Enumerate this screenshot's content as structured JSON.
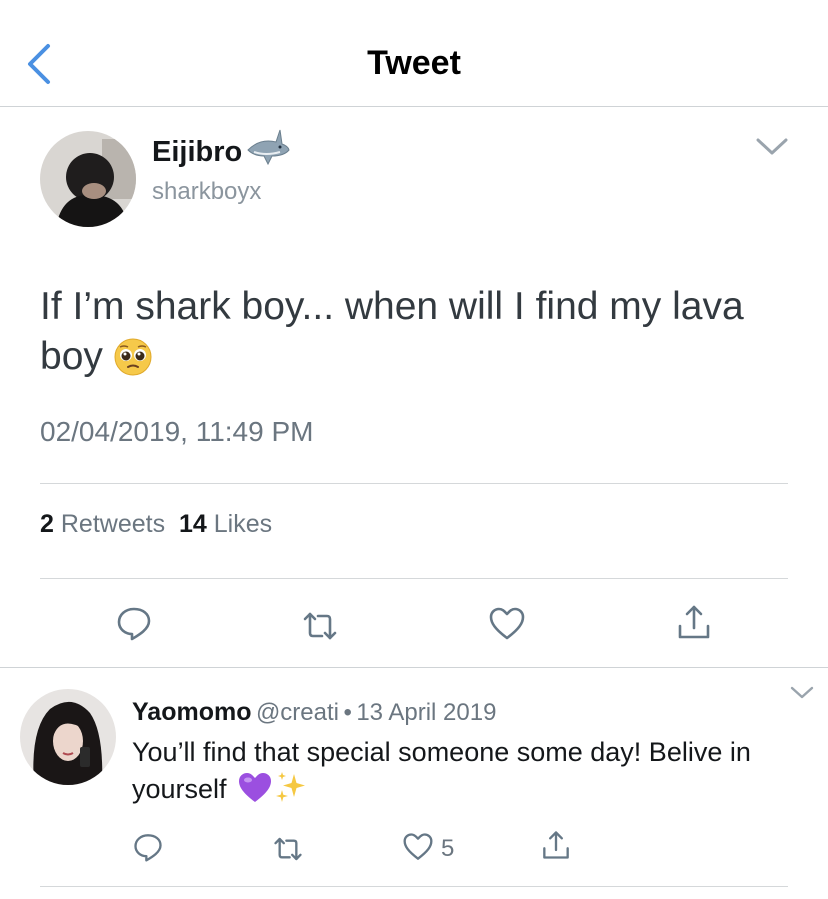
{
  "header": {
    "title": "Tweet",
    "accent": "#4a90e2"
  },
  "tweet": {
    "author_name": "Eijibro",
    "handle": "sharkboyx",
    "name_emoji": "shark-emoji",
    "text": "If I’m shark boy... when will I find my lava boy",
    "text_emoji": "pleading-face-emoji",
    "timestamp": "02/04/2019, 11:49 PM",
    "retweets": {
      "count": "2",
      "label": "Retweets"
    },
    "likes": {
      "count": "14",
      "label": "Likes"
    },
    "actions": [
      "reply-icon",
      "retweet-icon",
      "like-icon",
      "share-icon"
    ]
  },
  "reply": {
    "name": "Yaomomo",
    "handle": "@creati",
    "separator": "•",
    "date": "13 April 2019",
    "text": "You’ll find that special someone some day! Belive in yourself",
    "emojis": [
      "purple-heart-emoji",
      "sparkles-emoji"
    ],
    "like_count": "5"
  }
}
